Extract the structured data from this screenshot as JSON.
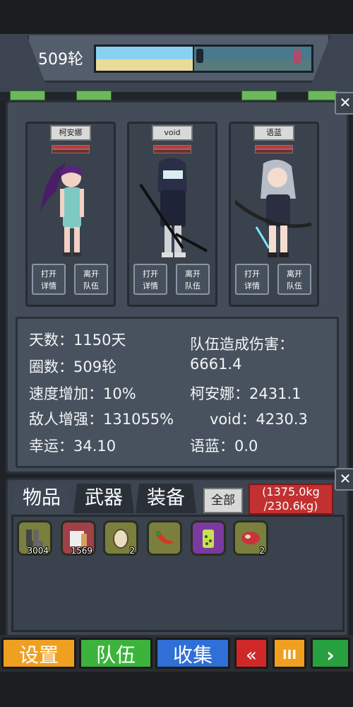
{
  "round": {
    "label": "509轮"
  },
  "team": {
    "members": [
      {
        "name": "柯安娜",
        "btn_open": [
          "打开",
          "详情"
        ],
        "btn_leave": [
          "离开",
          "队伍"
        ]
      },
      {
        "name": "void",
        "btn_open": [
          "打开",
          "详情"
        ],
        "btn_leave": [
          "离开",
          "队伍"
        ]
      },
      {
        "name": "语蓝",
        "btn_open": [
          "打开",
          "详情"
        ],
        "btn_leave": [
          "离开",
          "队伍"
        ]
      }
    ]
  },
  "stats": {
    "days": "天数：1150天",
    "laps": "圈数：509轮",
    "speed": "速度增加：10%",
    "enemy": "敌人增强：131055%",
    "luck": "幸运：34.10",
    "damage_title": "队伍造成伤害：",
    "damage_total": "6661.4",
    "dmg_keana": "柯安娜：2431.1",
    "dmg_void": "void：4230.3",
    "dmg_yulan": "语蓝：0.0"
  },
  "inventory": {
    "tabs": [
      "物品",
      "武器",
      "装备"
    ],
    "all_label": "全部",
    "weight": [
      "(1375.0kg",
      "/230.6kg)"
    ],
    "items": [
      {
        "icon": "boots-icon",
        "count": "3004"
      },
      {
        "icon": "scroll-icon",
        "count": "1569"
      },
      {
        "icon": "egg-icon",
        "count": "2"
      },
      {
        "icon": "chili-icon",
        "count": ""
      },
      {
        "icon": "potion-jar-icon",
        "count": ""
      },
      {
        "icon": "meat-icon",
        "count": "2"
      }
    ]
  },
  "nav": {
    "settings": "设置",
    "team": "队伍",
    "collect": "收集",
    "rewind": "«",
    "pause": "III",
    "play": "›"
  },
  "colors": {
    "settings": "#f0a020",
    "team": "#3cb43c",
    "collect": "#2f6fd6",
    "control": "#d02828",
    "play": "#28a040"
  }
}
